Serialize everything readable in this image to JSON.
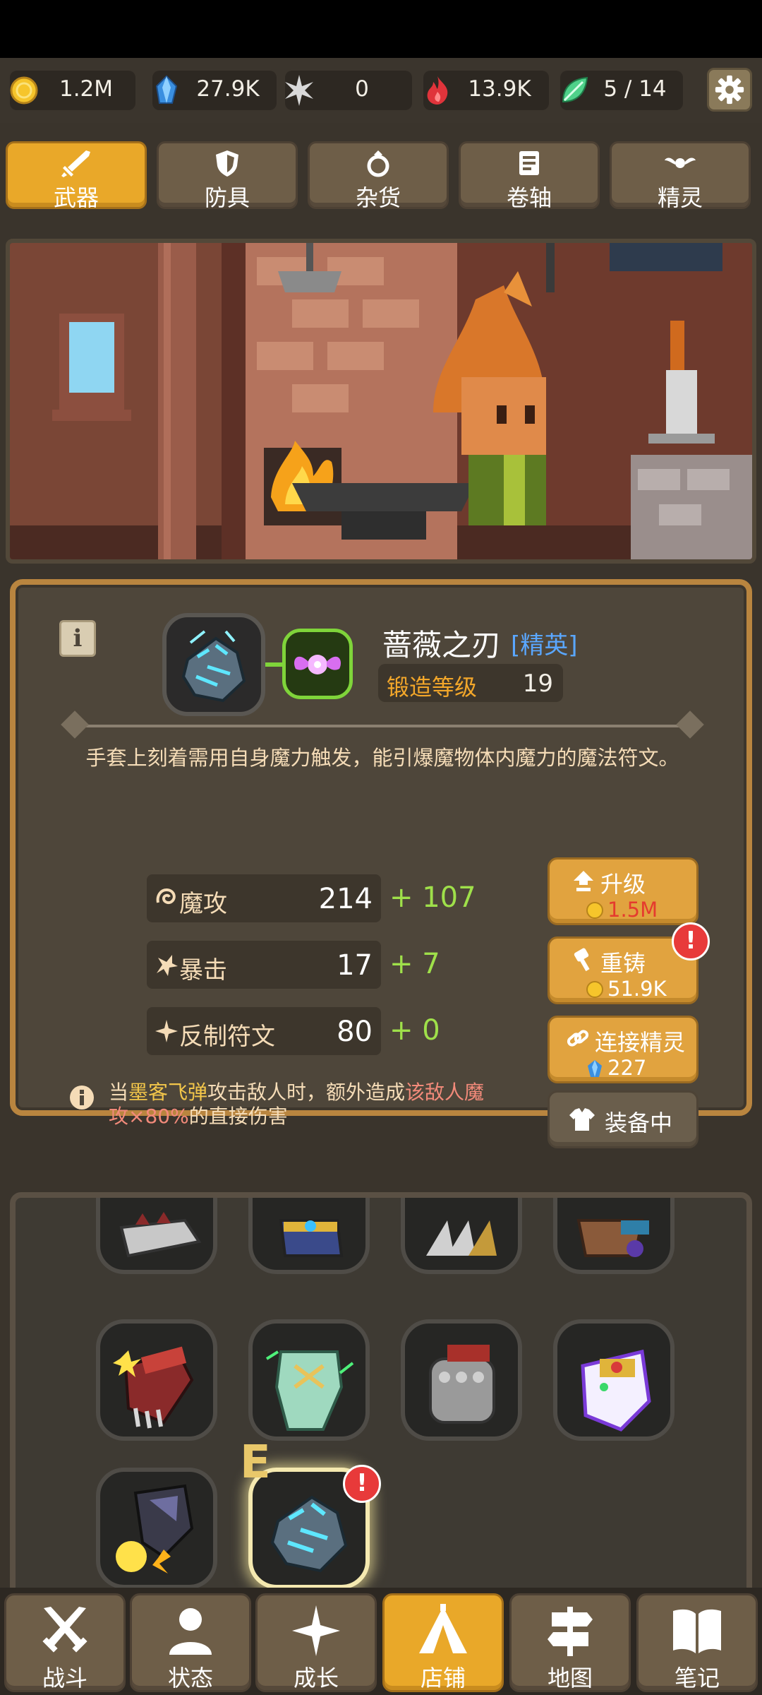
{
  "resources": [
    {
      "icon": "gold-coin-icon",
      "value": "1.2M"
    },
    {
      "icon": "blue-crystal-icon",
      "value": "27.9K"
    },
    {
      "icon": "star-shard-icon",
      "value": "0"
    },
    {
      "icon": "red-flame-icon",
      "value": "13.9K"
    },
    {
      "icon": "green-leaf-crystal-icon",
      "value": "5 / 14"
    }
  ],
  "tabs": [
    {
      "label": "武器",
      "icon": "sword-icon",
      "active": true
    },
    {
      "label": "防具",
      "icon": "shield-icon",
      "active": false
    },
    {
      "label": "杂货",
      "icon": "ring-icon",
      "active": false
    },
    {
      "label": "卷轴",
      "icon": "scroll-icon",
      "active": false
    },
    {
      "label": "精灵",
      "icon": "spirit-icon",
      "active": false
    }
  ],
  "item": {
    "name": "蔷薇之刃",
    "rank": "[精英]",
    "forge_label": "锻造等级",
    "forge_level": "19",
    "description": "手套上刻着需用自身魔力触发，能引爆魔物体内魔力的魔法符文。",
    "stats": [
      {
        "icon": "magic-swirl-icon",
        "label": "魔攻",
        "value": "214",
        "bonus": "+ 107"
      },
      {
        "icon": "crit-burst-icon",
        "label": "暴击",
        "value": "17",
        "bonus": "+ 7"
      },
      {
        "icon": "rune-star-icon",
        "label": "反制符文",
        "value": "80",
        "bonus": "+ 0"
      }
    ],
    "effect": {
      "part1": "当",
      "highlight1": "墨客飞弹",
      "part2": "攻击敌人时，额外造成",
      "highlight2": "该敌人魔攻×80%",
      "part3": "的直接伤害"
    }
  },
  "actions": {
    "upgrade": {
      "label": "升级",
      "cost": "1.5M"
    },
    "reforge": {
      "label": "重铸",
      "cost": "51.9K",
      "alert": "!"
    },
    "link_spirit": {
      "label": "连接精灵",
      "cost": "227"
    },
    "equipped": {
      "label": "装备中"
    }
  },
  "inventory": {
    "equipped_mark": "E",
    "alert": "!"
  },
  "bottom_nav": [
    {
      "label": "战斗",
      "icon": "crossed-swords-icon",
      "active": false
    },
    {
      "label": "状态",
      "icon": "person-icon",
      "active": false
    },
    {
      "label": "成长",
      "icon": "sparkle-icon",
      "active": false
    },
    {
      "label": "店铺",
      "icon": "tent-icon",
      "active": true
    },
    {
      "label": "地图",
      "icon": "signpost-icon",
      "active": false
    },
    {
      "label": "笔记",
      "icon": "open-book-icon",
      "active": false
    }
  ],
  "colors": {
    "accent": "#e9a829",
    "panel": "#4e463a",
    "bonus_green": "#9fe04a",
    "rank_blue": "#5aa7ff",
    "cost_red": "#e53b2e"
  }
}
